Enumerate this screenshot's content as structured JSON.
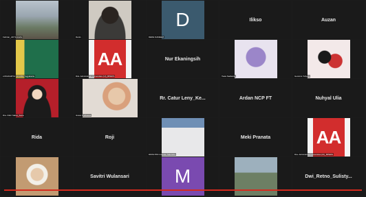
{
  "participants": [
    {
      "name": "",
      "label": "Febrian_AR Tennahu",
      "kind": "photo",
      "bg": "#8e9aa6"
    },
    {
      "name": "",
      "label": "Danin",
      "kind": "face",
      "bg": "#c9c5bd"
    },
    {
      "name": "",
      "label": "DEDE NADEEM",
      "kind": "letter",
      "letter": "D",
      "bg": "#3b5a6e"
    },
    {
      "name": "Ilikso",
      "label": "",
      "kind": "name"
    },
    {
      "name": "Auzan",
      "label": "",
      "kind": "name"
    },
    {
      "name": "",
      "label": "LOKAKARYA ULNABA Yogyakarta",
      "kind": "photo",
      "bg": "#1d6b4a"
    },
    {
      "name": "",
      "label": "Dist. Administrasi Universitas (UI)_BPEDS",
      "kind": "aa"
    },
    {
      "name": "Nur Ekaningsih",
      "label": "",
      "kind": "name"
    },
    {
      "name": "",
      "label": "Tsela Nadianta",
      "kind": "photo",
      "bg": "#d7d7e6"
    },
    {
      "name": "",
      "label": "Guzaimi Yuliyani",
      "kind": "photo",
      "bg": "#f0e3e3"
    },
    {
      "name": "",
      "label": "Dra. Fiktri Sabat_Siehe",
      "kind": "photo",
      "bg": "#b51f2a"
    },
    {
      "name": "",
      "label": "Grace Prabawati",
      "kind": "face",
      "bg": "#ded6cf"
    },
    {
      "name": "Rr. Catur Leny_Ke...",
      "label": "",
      "kind": "name"
    },
    {
      "name": "Ardan NCP FT",
      "label": "",
      "kind": "name"
    },
    {
      "name": "Nuhyal Ulia",
      "label": "",
      "kind": "name"
    },
    {
      "name": "Rida",
      "label": "",
      "kind": "name"
    },
    {
      "name": "Roji",
      "label": "",
      "kind": "name"
    },
    {
      "name": "",
      "label": "DIKSI PKK Institute Satutoha",
      "kind": "photo",
      "bg": "#4c6e94"
    },
    {
      "name": "Meki Pranata",
      "label": "",
      "kind": "name"
    },
    {
      "name": "",
      "label": "Dra. Administrasi Universitas (UI)_BPEDS",
      "kind": "aa"
    },
    {
      "name": "",
      "label": "",
      "kind": "photo",
      "bg": "#c8a27a"
    },
    {
      "name": "Savitri Wulansari",
      "label": "",
      "kind": "name"
    },
    {
      "name": "",
      "label": "",
      "kind": "letter",
      "letter": "M",
      "bg": "#7a4ab0"
    },
    {
      "name": "",
      "label": "",
      "kind": "photo",
      "bg": "#74858f"
    },
    {
      "name": "Dwi_Retno_Sulisty...",
      "label": "",
      "kind": "name"
    }
  ],
  "aa_text": "AA",
  "accent": "#d62a1e"
}
